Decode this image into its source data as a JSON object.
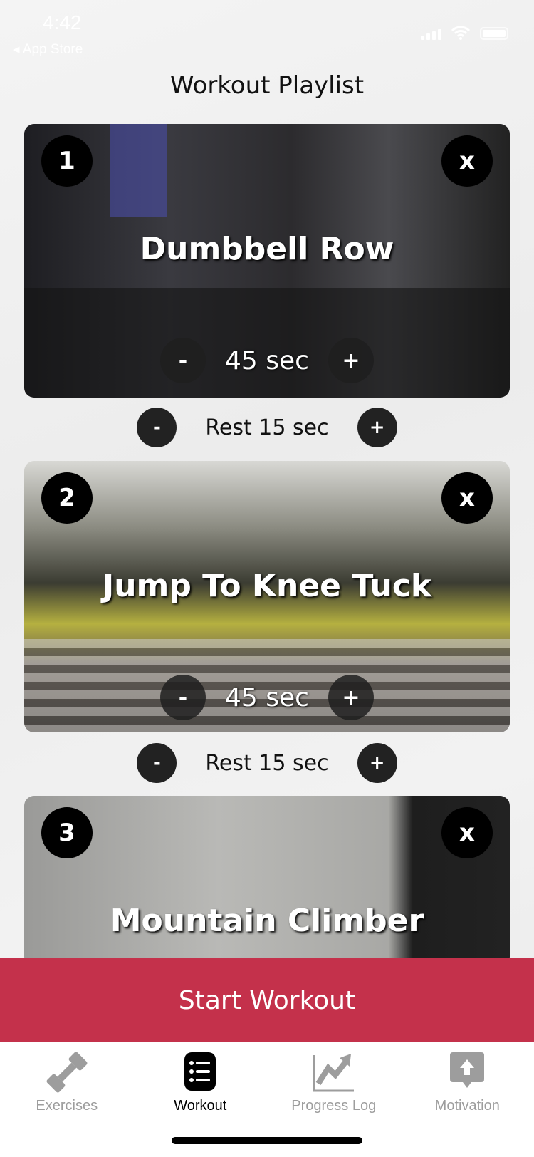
{
  "status": {
    "time": "4:42",
    "back": "App Store"
  },
  "title": "Workout Playlist",
  "exercises": [
    {
      "number": "1",
      "name": "Dumbbell Row",
      "duration": "45 sec",
      "close": "x"
    },
    {
      "number": "2",
      "name": "Jump To Knee Tuck",
      "duration": "45 sec",
      "close": "x"
    },
    {
      "number": "3",
      "name": "Mountain Climber",
      "close": "x"
    }
  ],
  "rests": [
    "Rest 15 sec",
    "Rest 15 sec"
  ],
  "minus": "-",
  "plus": "+",
  "start_button": "Start Workout",
  "tabs": [
    {
      "label": "Exercises",
      "icon": "dumbbell-icon"
    },
    {
      "label": "Workout",
      "icon": "list-icon",
      "active": true
    },
    {
      "label": "Progress Log",
      "icon": "chart-icon"
    },
    {
      "label": "Motivation",
      "icon": "upload-icon"
    }
  ],
  "colors": {
    "accent": "#c4314b"
  }
}
